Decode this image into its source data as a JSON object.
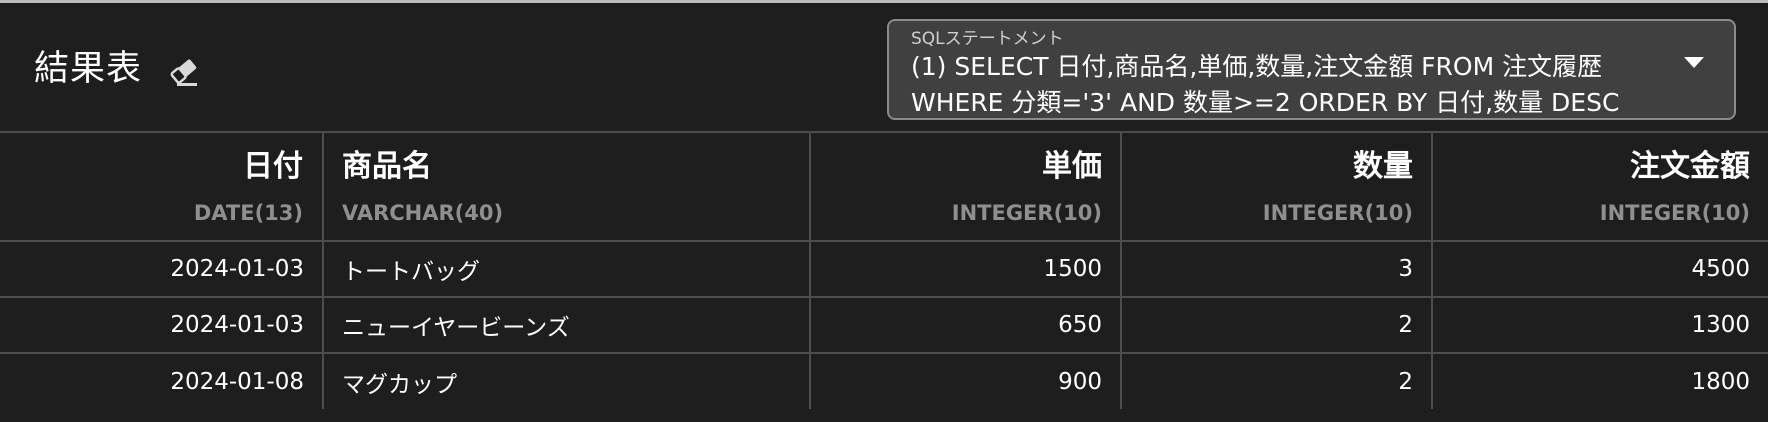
{
  "header": {
    "title": "結果表",
    "eraser_icon": "eraser-icon"
  },
  "sql": {
    "label": "SQLステートメント",
    "statement": "(1) SELECT 日付,商品名,単価,数量,注文金額 FROM 注文履歴 WHERE 分類='3' AND 数量>=2 ORDER BY 日付,数量 DESC",
    "dropdown_icon": "chevron-down-icon"
  },
  "table": {
    "columns": [
      {
        "name": "日付",
        "type": "DATE(13)"
      },
      {
        "name": "商品名",
        "type": "VARCHAR(40)"
      },
      {
        "name": "単価",
        "type": "INTEGER(10)"
      },
      {
        "name": "数量",
        "type": "INTEGER(10)"
      },
      {
        "name": "注文金額",
        "type": "INTEGER(10)"
      }
    ],
    "rows": [
      [
        "2024-01-03",
        "トートバッグ",
        "1500",
        "3",
        "4500"
      ],
      [
        "2024-01-03",
        "ニューイヤービーンズ",
        "650",
        "2",
        "1300"
      ],
      [
        "2024-01-08",
        "マグカップ",
        "900",
        "2",
        "1800"
      ]
    ]
  }
}
